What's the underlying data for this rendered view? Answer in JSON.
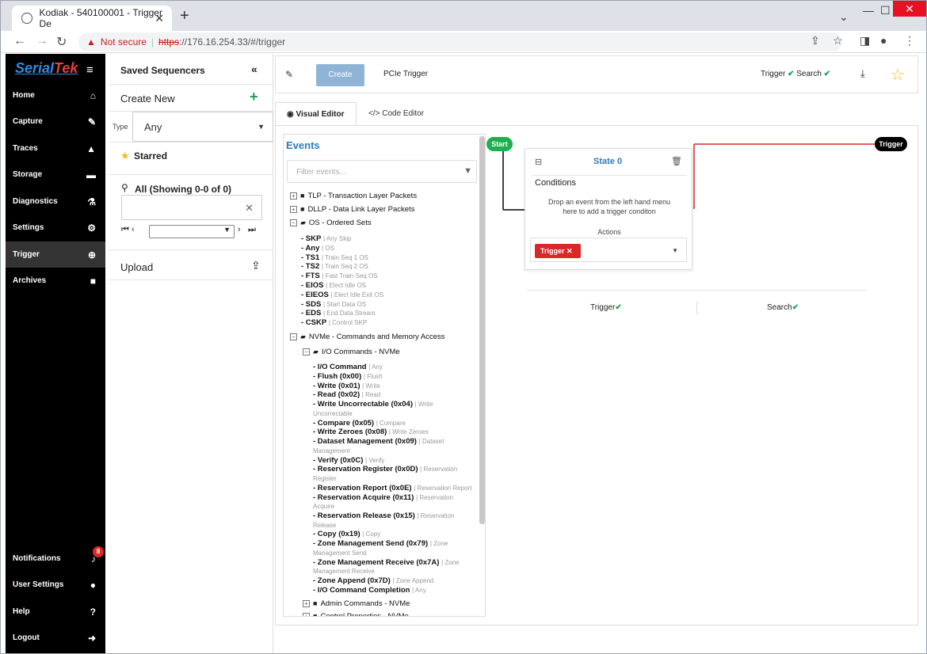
{
  "browser": {
    "tab_title": "Kodiak - 540100001 - Trigger De",
    "not_secure": "Not secure",
    "url_scheme": "https",
    "url_rest": "://176.16.254.33/#/trigger"
  },
  "sidebar": {
    "logo_a": "Serial",
    "logo_b": "Tek",
    "items": [
      {
        "label": "Home",
        "icon": "home-icon"
      },
      {
        "label": "Capture",
        "icon": "wrench-icon"
      },
      {
        "label": "Traces",
        "icon": "chart-icon"
      },
      {
        "label": "Storage",
        "icon": "drive-icon"
      },
      {
        "label": "Diagnostics",
        "icon": "flask-icon"
      },
      {
        "label": "Settings",
        "icon": "gear-icon"
      },
      {
        "label": "Trigger",
        "icon": "crosshair-icon"
      },
      {
        "label": "Archives",
        "icon": "archive-icon"
      }
    ],
    "bottom_items": [
      {
        "label": "Notifications",
        "icon": "bell-icon"
      },
      {
        "label": "User Settings",
        "icon": "user-icon"
      },
      {
        "label": "Help",
        "icon": "help-icon"
      },
      {
        "label": "Logout",
        "icon": "logout-icon"
      }
    ],
    "notification_count": "8"
  },
  "sequencers": {
    "title": "Saved Sequencers",
    "create_new": "Create New",
    "type_label": "Type",
    "type_value": "Any",
    "starred": "Starred",
    "all_label": "All (Showing 0-0 of 0)",
    "upload": "Upload"
  },
  "topbar": {
    "create_label": "Create",
    "trigger_name": "PCIe Trigger",
    "status_trigger": "Trigger",
    "status_search": "Search"
  },
  "tabs": {
    "visual": "Visual Editor",
    "code": "Code Editor"
  },
  "events": {
    "title": "Events",
    "filter_placeholder": "Filter events...",
    "groups": {
      "tlp": "TLP - Transaction Layer Packets",
      "dllp": "DLLP - Data Link Layer Packets",
      "os": "OS - Ordered Sets",
      "nvme": "NVMe - Commands and Memory Access",
      "io": "I/O Commands - NVMe",
      "admin": "Admin Commands - NVMe",
      "control": "Control Properties - NVMe"
    },
    "os_items": [
      {
        "name": "- SKP",
        "desc": "Any Skip"
      },
      {
        "name": "- Any",
        "desc": "OS"
      },
      {
        "name": "- TS1",
        "desc": "Train Seq 1 OS"
      },
      {
        "name": "- TS2",
        "desc": "Train Seq 2 OS"
      },
      {
        "name": "- FTS",
        "desc": "Fast Train Seq OS"
      },
      {
        "name": "- EIOS",
        "desc": "Elect Idle OS"
      },
      {
        "name": "- EIEOS",
        "desc": "Elect Idle Exit OS"
      },
      {
        "name": "- SDS",
        "desc": "Start Data OS"
      },
      {
        "name": "- EDS",
        "desc": "End Data Stream"
      },
      {
        "name": "- CSKP",
        "desc": "Control SKP"
      }
    ],
    "io_items": [
      {
        "name": "- I/O Command",
        "desc": "Any"
      },
      {
        "name": "- Flush (0x00)",
        "desc": "Flush"
      },
      {
        "name": "- Write (0x01)",
        "desc": "Write"
      },
      {
        "name": "- Read (0x02)",
        "desc": "Read"
      },
      {
        "name": "- Write Uncorrectable (0x04)",
        "desc": "Write",
        "desc2": "Uncorrectable"
      },
      {
        "name": "- Compare (0x05)",
        "desc": "Compare"
      },
      {
        "name": "- Write Zeroes (0x08)",
        "desc": "Write Zeroes"
      },
      {
        "name": "- Dataset Management (0x09)",
        "desc": "Dataset",
        "desc2": "Management"
      },
      {
        "name": "- Verify (0x0C)",
        "desc": "Verify"
      },
      {
        "name": "- Reservation Register (0x0D)",
        "desc": "Reservation",
        "desc2": "Register"
      },
      {
        "name": "- Reservation Report (0x0E)",
        "desc": "Reservation Report"
      },
      {
        "name": "- Reservation Acquire (0x11)",
        "desc": "Reservation",
        "desc2": "Acquire"
      },
      {
        "name": "- Reservation Release (0x15)",
        "desc": "Reservation",
        "desc2": "Release"
      },
      {
        "name": "- Copy (0x19)",
        "desc": "Copy"
      },
      {
        "name": "- Zone Management Send (0x79)",
        "desc": "Zone",
        "desc2": "Management Send"
      },
      {
        "name": "- Zone Management Receive (0x7A)",
        "desc": "Zone",
        "desc2": "Management Receive"
      },
      {
        "name": "- Zone Append (0x7D)",
        "desc": "Zone Append"
      },
      {
        "name": "- I/O Command Completion",
        "desc": "Any"
      }
    ]
  },
  "canvas": {
    "start": "Start",
    "trigger": "Trigger",
    "state_title": "State 0",
    "conditions": "Conditions",
    "drop_line1": "Drop an event from the left hand menu",
    "drop_line2": "here to add a trigger conditon",
    "actions": "Actions",
    "action_chip": "Trigger",
    "summary_trigger": "Trigger",
    "summary_search": "Search"
  },
  "colors": {
    "accent": "#2b7bb9",
    "ok": "#1aa251",
    "danger": "#d92828",
    "start": "#1db04f"
  }
}
